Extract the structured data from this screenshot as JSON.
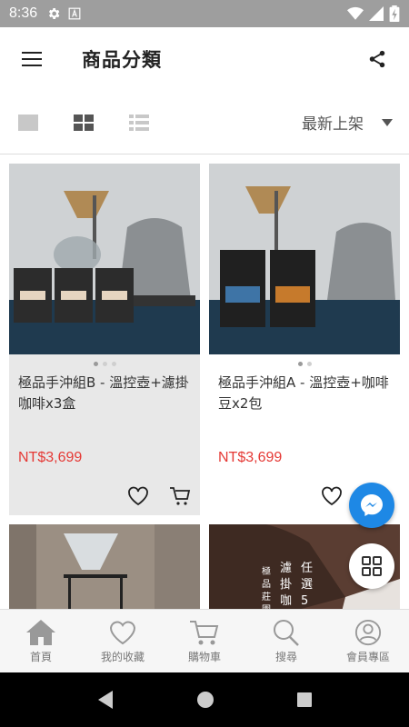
{
  "status_bar": {
    "time": "8:36"
  },
  "app_bar": {
    "title": "商品分類"
  },
  "view_bar": {
    "sort_label": "最新上架"
  },
  "products": [
    {
      "name": "極品手沖組B - 溫控壺+濾掛咖啡x3盒",
      "price": "NT$3,699"
    },
    {
      "name": "極品手沖組A - 溫控壺+咖啡豆x2包",
      "price": "NT$3,699"
    }
  ],
  "partial_card_text": [
    "濾",
    "掛",
    "咖",
    "任",
    "選",
    "5",
    "極",
    "品",
    "莊",
    "園"
  ],
  "bottom_nav": [
    {
      "label": "首頁",
      "icon": "home-icon"
    },
    {
      "label": "我的收藏",
      "icon": "heart-icon"
    },
    {
      "label": "購物車",
      "icon": "cart-icon"
    },
    {
      "label": "搜尋",
      "icon": "search-icon"
    },
    {
      "label": "會員專區",
      "icon": "account-icon"
    }
  ],
  "colors": {
    "price": "#e53935",
    "messenger": "#1e88e5",
    "status_bar": "#9e9e9e"
  }
}
